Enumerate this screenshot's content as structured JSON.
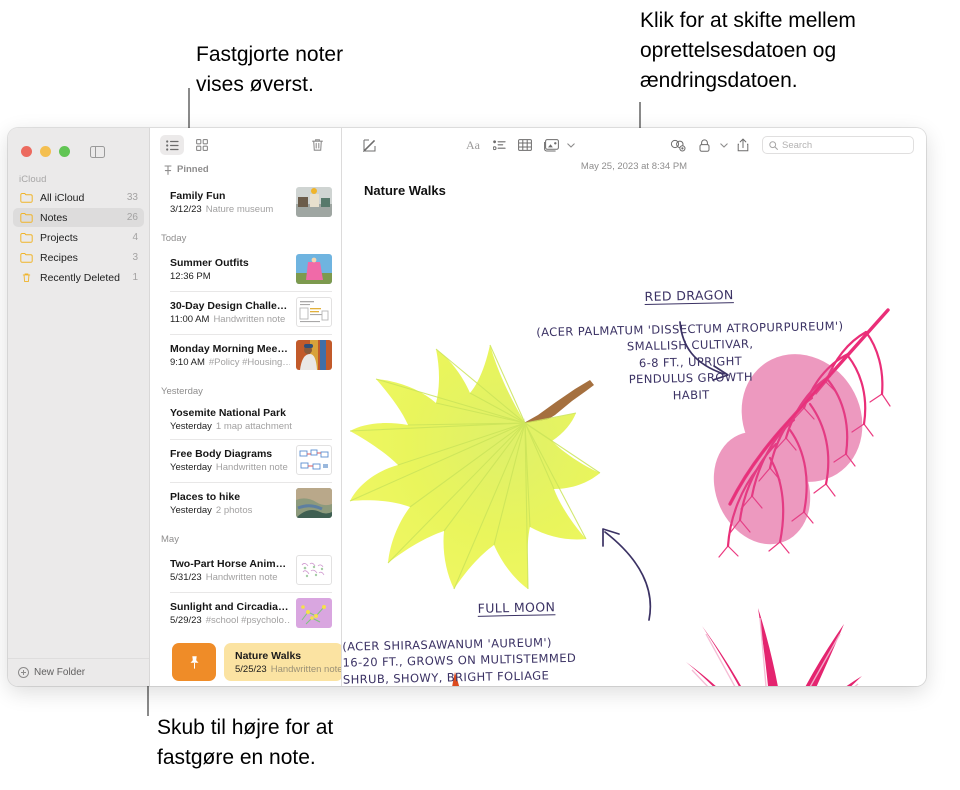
{
  "callouts": {
    "top_left": "Fastgjorte noter\nvises øverst.",
    "top_right": "Klik for at skifte mellem\noprettelsesdatoen og\nændringsdatoen.",
    "bottom_left": "Skub til højre for at\nfastgøre en note."
  },
  "sidebar": {
    "section_label": "iCloud",
    "items": [
      {
        "label": "All iCloud",
        "count": "33",
        "icon": "folder-icon",
        "selected": false
      },
      {
        "label": "Notes",
        "count": "26",
        "icon": "folder-icon",
        "selected": true
      },
      {
        "label": "Projects",
        "count": "4",
        "icon": "folder-icon",
        "selected": false
      },
      {
        "label": "Recipes",
        "count": "3",
        "icon": "folder-icon",
        "selected": false
      },
      {
        "label": "Recently Deleted",
        "count": "1",
        "icon": "trash-icon",
        "selected": false
      }
    ],
    "new_folder_label": "New Folder",
    "traffic_lights": [
      "close",
      "minimize",
      "zoom"
    ]
  },
  "notelist": {
    "toolbar": {
      "list_view": "list-view-icon",
      "gallery_view": "gallery-view-icon",
      "delete": "trash-icon"
    },
    "pinned_label": "Pinned",
    "groups": [
      {
        "label": "",
        "notes": [
          {
            "title": "Family Fun",
            "date": "3/12/23",
            "meta": "Nature museum",
            "thumb": "photo-museum"
          }
        ]
      },
      {
        "label": "Today",
        "notes": [
          {
            "title": "Summer Outfits",
            "date": "12:36 PM",
            "meta": "",
            "thumb": "photo-dress"
          },
          {
            "title": "30-Day Design Challen…",
            "date": "11:00 AM",
            "meta": "Handwritten note",
            "thumb": "doc-sketch"
          },
          {
            "title": "Monday Morning Meeting",
            "date": "9:10 AM",
            "meta": "#Policy #Housing…",
            "thumb": "photo-person"
          }
        ]
      },
      {
        "label": "Yesterday",
        "notes": [
          {
            "title": "Yosemite National Park",
            "date": "Yesterday",
            "meta": "1 map attachment",
            "thumb": ""
          },
          {
            "title": "Free Body Diagrams",
            "date": "Yesterday",
            "meta": "Handwritten note",
            "thumb": "doc-diagram"
          },
          {
            "title": "Places to hike",
            "date": "Yesterday",
            "meta": "2 photos",
            "thumb": "photo-coast"
          }
        ]
      },
      {
        "label": "May",
        "notes": [
          {
            "title": "Two-Part Horse Anima…",
            "date": "5/31/23",
            "meta": "Handwritten note",
            "thumb": "doc-scribble"
          },
          {
            "title": "Sunlight and Circadian…",
            "date": "5/29/23",
            "meta": "#school #psycholo…",
            "thumb": "photo-purple"
          }
        ]
      }
    ],
    "swipe_row": {
      "pin_action_icon": "pin-icon",
      "title": "Nature Walks",
      "date": "5/25/23",
      "meta": "Handwritten note",
      "action_color": "#ef8c28",
      "row_color": "#fbe3a2"
    }
  },
  "editor": {
    "toolbar": {
      "compose": "compose-icon",
      "format": "Aa",
      "checklist": "checklist-icon",
      "table": "table-icon",
      "media": "media-icon",
      "media_chevron": "chevron-down-icon",
      "collaborate": "collaborate-icon",
      "lock": "lock-icon",
      "lock_chevron": "chevron-down-icon",
      "share": "share-icon",
      "search_placeholder": "Search",
      "search_value": ""
    },
    "date_stamp": "May 25, 2023 at 8:34 PM",
    "note_title": "Nature Walks",
    "handwriting": {
      "red_dragon_title": "RED DRAGON",
      "red_dragon_body": "(ACER PALMATUM 'DISSECTUM ATROPURPUREUM')\nSMALLISH CULTIVAR,\n6-8 FT., UPRIGHT\nPENDULUS GROWTH\nHABIT",
      "full_moon_title": "FULL MOON",
      "full_moon_body": "(ACER SHIRASAWANUM 'AUREUM')\n16-20 FT., GROWS ON MULTISTEMMED\nSHRUB, SHOWY, BRIGHT FOLIAGE"
    },
    "illustrations": [
      {
        "name": "yellow-maple-leaf",
        "color": "#e9f25a"
      },
      {
        "name": "pink-lacy-maple-leaf",
        "color": "#ea2e78"
      },
      {
        "name": "magenta-maple-leaf",
        "color": "#e4246f"
      },
      {
        "name": "orange-leaf-fragment",
        "color": "#e24a1e"
      }
    ]
  },
  "colors": {
    "accent_orange": "#ef8c28",
    "note_yellow": "#fbe3a2",
    "folder_icon": "#f0b429",
    "ink": "#3b3264"
  }
}
